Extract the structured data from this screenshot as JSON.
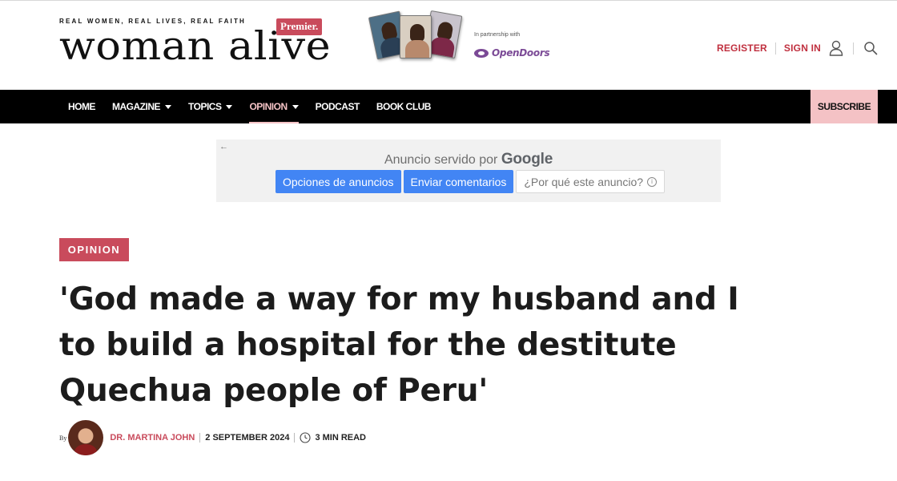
{
  "header": {
    "tagline": "REAL WOMEN, REAL LIVES, REAL FAITH",
    "brand": "woman alive",
    "premier_badge": "Premier.",
    "partnership_text": "In partnership with",
    "partner_name": "OpenDoors",
    "register_label": "REGISTER",
    "signin_label": "SIGN IN"
  },
  "nav": {
    "items": [
      {
        "label": "HOME"
      },
      {
        "label": "MAGAZINE"
      },
      {
        "label": "TOPICS"
      },
      {
        "label": "OPINION"
      },
      {
        "label": "PODCAST"
      },
      {
        "label": "BOOK CLUB"
      }
    ],
    "subscribe_label": "SUBSCRIBE"
  },
  "ad": {
    "served_text": "Anuncio servido por",
    "served_brand": "Google",
    "options_label": "Opciones de anuncios",
    "feedback_label": "Enviar comentarios",
    "why_label": "¿Por qué este anuncio?"
  },
  "article": {
    "category": "OPINION",
    "title": "'God made a way for my husband and I to build a hospital for the destitute Quechua people of Peru'",
    "by_label": "By",
    "author": "DR. MARTINA JOHN",
    "date": "2 SEPTEMBER 2024",
    "read_time": "3 MIN READ"
  },
  "colors": {
    "accent": "#c94b5c",
    "nav_background": "#000000",
    "subscribe_background": "#f4c2c5",
    "partner_purple": "#7b4a96",
    "ad_button_blue": "#4285f4"
  },
  "icons": [
    "user-icon",
    "search-icon",
    "clock-icon",
    "info-icon",
    "back-arrow-icon",
    "opendoors-logo-icon"
  ]
}
